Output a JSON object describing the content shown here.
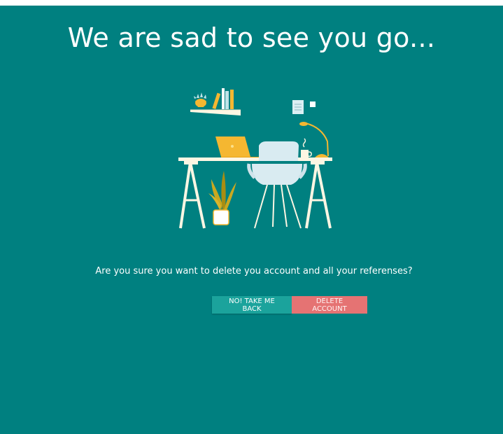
{
  "page": {
    "title": "We are sad to see you go...",
    "question": "Are you sure you want to delete you account and all your referenses?"
  },
  "actions": {
    "back_label": "NO! TAKE ME BACK",
    "delete_label": "DELETE ACCOUNT"
  },
  "colors": {
    "background": "#008080",
    "back_button": "#1ba39c",
    "delete_button": "#e57373"
  },
  "illustration": {
    "subject": "desk-workspace-illustration"
  }
}
